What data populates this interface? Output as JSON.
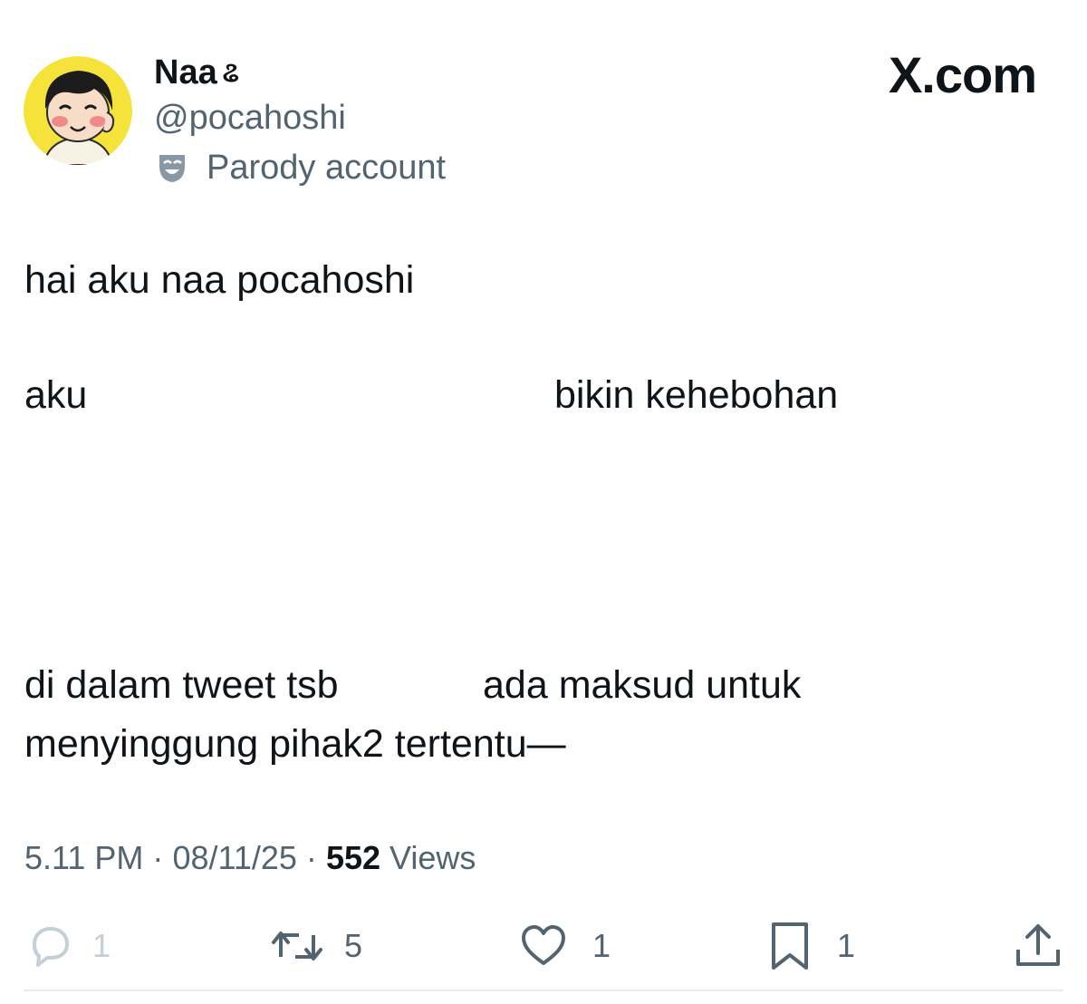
{
  "brand": "X.com",
  "user": {
    "display_name": "Naa",
    "name_glyph": "ଌ",
    "handle": "@pocahoshi",
    "badge_label": "Parody account",
    "avatar_icon": "cartoon-avatar",
    "badge_icon": "theater-mask-icon"
  },
  "tweet": {
    "line1": "hai aku naa pocahoshi",
    "line2_left": "aku",
    "line2_right": "bikin kehebohan",
    "line3_left": "di dalam tweet tsb",
    "line3_right": "ada maksud untuk",
    "line4": "menyinggung pihak2 tertentu—"
  },
  "meta": {
    "time": "5.11 PM",
    "separator": "·",
    "date": "08/11/25",
    "views_count": "552",
    "views_label": "Views"
  },
  "actions": {
    "reply_count": "1",
    "repost_count": "5",
    "like_count": "1",
    "bookmark_count": "1"
  },
  "colors": {
    "text_primary": "#0f1419",
    "text_secondary": "#536471",
    "divider": "#e6ecf0"
  }
}
